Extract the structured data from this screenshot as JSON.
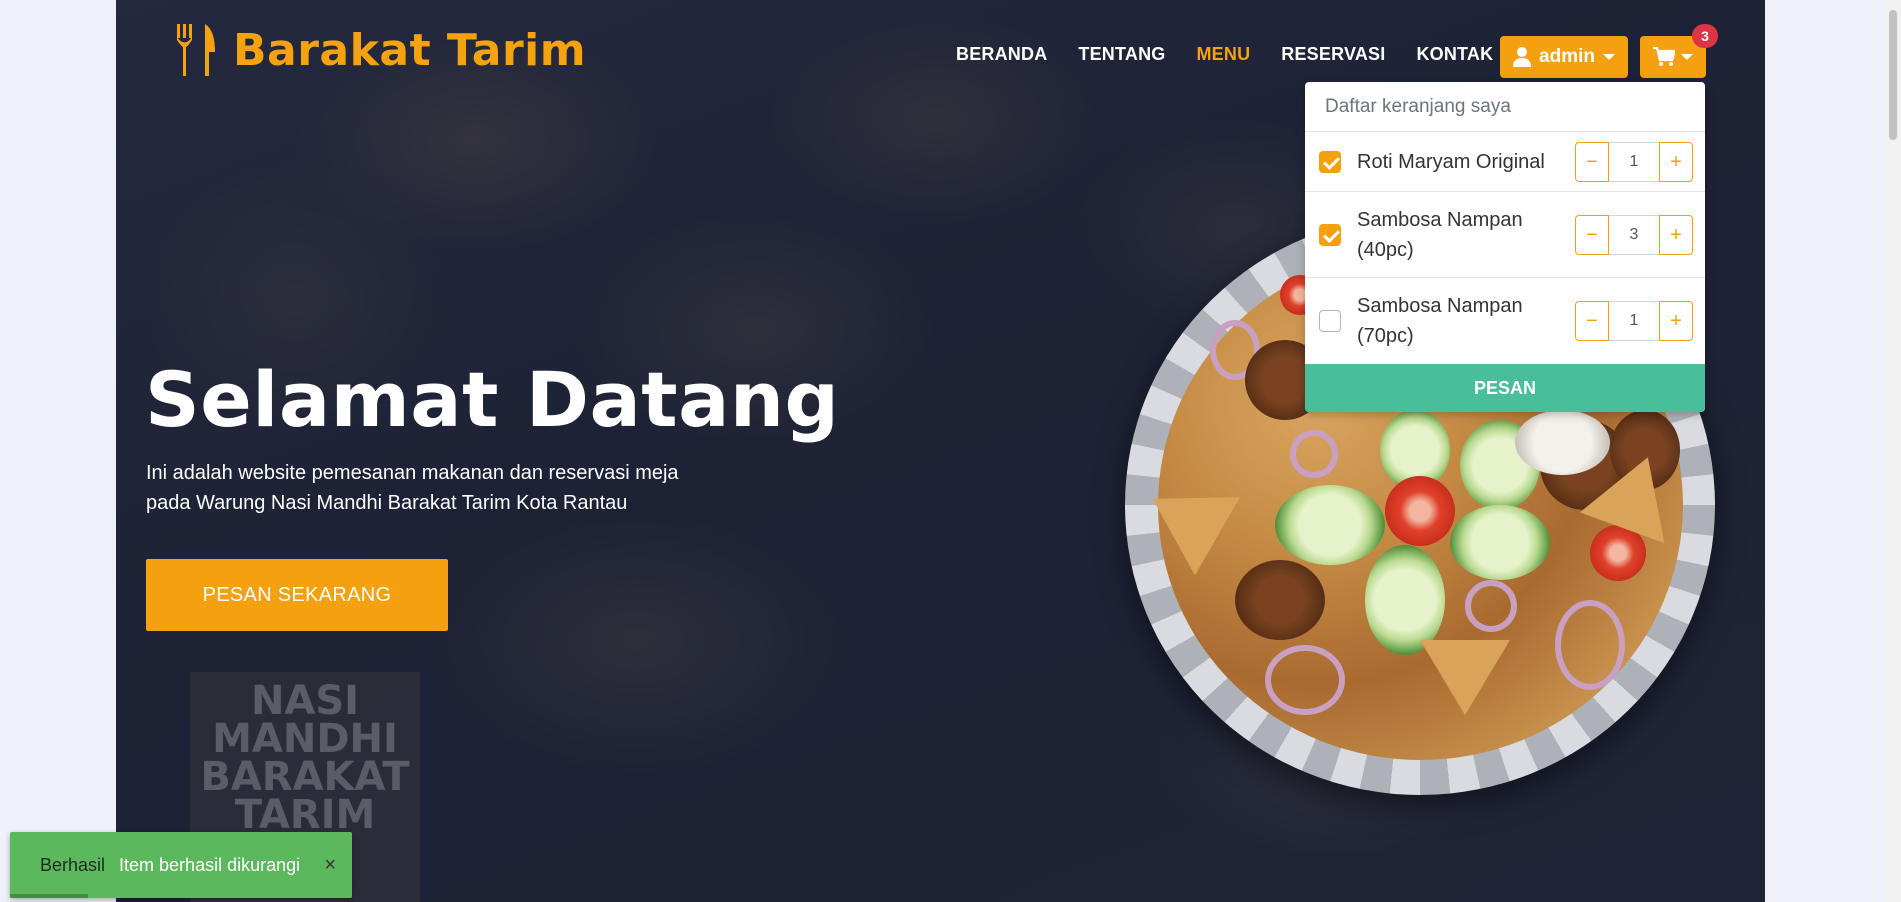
{
  "brand": {
    "name": "Barakat Tarim",
    "icon": "fork-knife-icon",
    "color": "#f5a210"
  },
  "nav": {
    "items": [
      {
        "label": "BERANDA",
        "active": false
      },
      {
        "label": "TENTANG",
        "active": false
      },
      {
        "label": "MENU",
        "active": true
      },
      {
        "label": "RESERVASI",
        "active": false
      },
      {
        "label": "KONTAK",
        "active": false
      }
    ],
    "admin_label": "admin",
    "admin_icon": "user-icon",
    "cart_icon": "cart-icon",
    "cart_count": "3"
  },
  "cart": {
    "header": "Daftar keranjang saya",
    "items": [
      {
        "name": "Roti Maryam Original",
        "qty": "1",
        "checked": true
      },
      {
        "name": "Sambosa Nampan (40pc)",
        "qty": "3",
        "checked": true
      },
      {
        "name": "Sambosa Nampan (70pc)",
        "qty": "1",
        "checked": false
      }
    ],
    "minus": "−",
    "plus": "+",
    "order_label": "PESAN"
  },
  "hero": {
    "title": "Selamat Datang",
    "description": "Ini adalah website pemesanan makanan dan reservasi meja pada Warung Nasi Mandhi Barakat Tarim Kota Rantau",
    "cta_label": "PESAN SEKARANG"
  },
  "toast": {
    "title": "Berhasil",
    "message": "Item berhasil dikurangi",
    "close": "×"
  },
  "colors": {
    "accent": "#f5a00f",
    "success": "#5cb85c",
    "order": "#48bf9a",
    "badge": "#dc3545"
  }
}
